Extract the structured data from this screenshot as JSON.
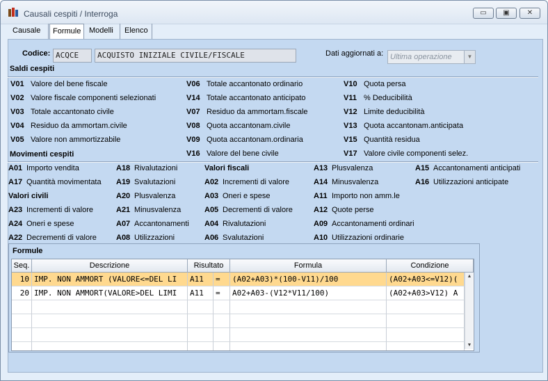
{
  "window": {
    "title": "Causali cespiti / Interroga",
    "min_symbol": "▭",
    "max_symbol": "▣",
    "close_symbol": "✕"
  },
  "tabs": [
    {
      "label": "Causale"
    },
    {
      "label": "Formule"
    },
    {
      "label": "Modelli"
    },
    {
      "label": "Elenco"
    }
  ],
  "header": {
    "codice_label": "Codice:",
    "codice_value": "ACQCE",
    "descr_value": "ACQUISTO INIZIALE CIVILE/FISCALE",
    "dati_label": "Dati aggiornati a:",
    "dati_value": "Ultima operazione",
    "dropdown_arrow": "▼"
  },
  "saldi": {
    "title": "Saldi cespiti",
    "items": [
      {
        "code": "V01",
        "label": "Valore del bene fiscale"
      },
      {
        "code": "V02",
        "label": "Valore fiscale componenti selezionati"
      },
      {
        "code": "V03",
        "label": "Totale accantonato civile"
      },
      {
        "code": "V04",
        "label": "Residuo da ammortam.civile"
      },
      {
        "code": "V05",
        "label": "Valore non ammortizzabile"
      },
      {
        "code": "V06",
        "label": "Totale accantonato ordinario"
      },
      {
        "code": "V14",
        "label": "Totale accantonato anticipato"
      },
      {
        "code": "V07",
        "label": "Residuo da ammortam.fiscale"
      },
      {
        "code": "V08",
        "label": "Quota accantonam.civile"
      },
      {
        "code": "V09",
        "label": "Quota accantonam.ordinaria"
      },
      {
        "code": "V16",
        "label": "Valore del bene civile"
      },
      {
        "code": "V10",
        "label": "Quota persa"
      },
      {
        "code": "V11",
        "label": "% Deducibilità"
      },
      {
        "code": "V12",
        "label": "Limite deducibilità"
      },
      {
        "code": "V13",
        "label": "Quota accantonam.anticipata"
      },
      {
        "code": "V15",
        "label": "Quantità residua"
      },
      {
        "code": "V17",
        "label": "Valore civile componenti selez."
      }
    ]
  },
  "movimenti": {
    "title": "Movimenti cespiti",
    "fiscali_title": "Valori fiscali",
    "civili_title": "Valori civili",
    "items": [
      {
        "code": "A01",
        "label": "Importo vendita"
      },
      {
        "code": "A17",
        "label": "Quantità movimentata"
      },
      {
        "code": "A23",
        "label": "Incrementi di valore"
      },
      {
        "code": "A24",
        "label": "Oneri e spese"
      },
      {
        "code": "A22",
        "label": "Decrementi di valore"
      },
      {
        "code": "A18",
        "label": "Rivalutazioni"
      },
      {
        "code": "A19",
        "label": "Svalutazioni"
      },
      {
        "code": "A20",
        "label": "Plusvalenza"
      },
      {
        "code": "A21",
        "label": "Minusvalenza"
      },
      {
        "code": "A07",
        "label": "Accantonamenti"
      },
      {
        "code": "A08",
        "label": "Utilizzazioni"
      },
      {
        "code": "A02",
        "label": "Incrementi di valore"
      },
      {
        "code": "A03",
        "label": "Oneri e spese"
      },
      {
        "code": "A05",
        "label": "Decrementi di valore"
      },
      {
        "code": "A04",
        "label": "Rivalutazioni"
      },
      {
        "code": "A06",
        "label": "Svalutazioni"
      },
      {
        "code": "A13",
        "label": "Plusvalenza"
      },
      {
        "code": "A14",
        "label": "Minusvalenza"
      },
      {
        "code": "A11",
        "label": "Importo non amm.le"
      },
      {
        "code": "A12",
        "label": "Quote perse"
      },
      {
        "code": "A09",
        "label": "Accantonamenti ordinari"
      },
      {
        "code": "A10",
        "label": "Utilizzazioni ordinarie"
      },
      {
        "code": "A15",
        "label": "Accantonamenti anticipati"
      },
      {
        "code": "A16",
        "label": "Utilizzazioni anticipate"
      }
    ]
  },
  "formule": {
    "title": "Formule",
    "columns": [
      "Seq.",
      "Descrizione",
      "Risultato",
      "Formula",
      "Condizione"
    ],
    "rows": [
      {
        "seq": "10",
        "descr": "IMP. NON AMMORT (VALORE<=DEL LI",
        "ris": "A11",
        "op": "=",
        "formula": "(A02+A03)*(100-V11)/100",
        "cond": "(A02+A03<=V12)("
      },
      {
        "seq": "20",
        "descr": "IMP. NON AMMORT(VALORE>DEL LIMI",
        "ris": "A11",
        "op": "=",
        "formula": "A02+A03-(V12*V11/100)",
        "cond": "(A02+A03>V12) A"
      }
    ],
    "scroll_up": "▲",
    "scroll_down": "▼"
  }
}
